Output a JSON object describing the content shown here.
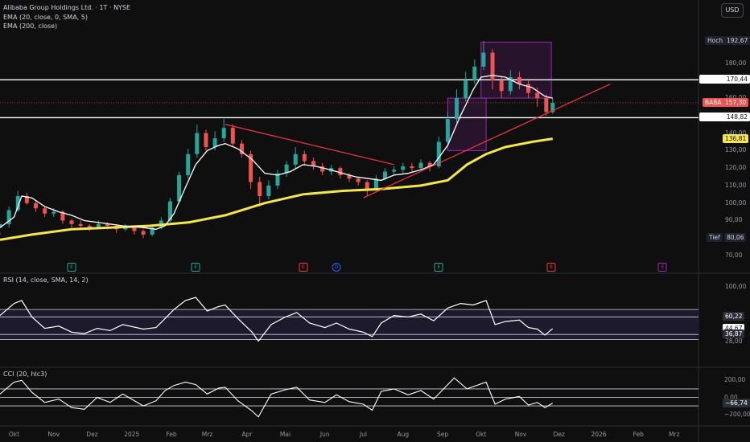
{
  "header": {
    "symbol_title": "Alibaba Group Holdings Ltd. · 1T · NYSE",
    "ema20": "EMA (20, close, 0, SMA, 5)",
    "ema200": "EMA (200, close)",
    "currency_button": "USD"
  },
  "colors": {
    "background": "#0f0f0f",
    "candle_up": "#26a69a",
    "candle_down": "#ef5350",
    "ema20": "#ffffff",
    "ema200": "#f5e649",
    "trendline": "#f23645",
    "box": "#9c27b0",
    "rsi_band": "#1e1a2e"
  },
  "price_tags": {
    "high_label": "Hoch",
    "high_value": "192,67",
    "low_label": "Tief",
    "low_value": "80,06",
    "symbol": "BABA",
    "last": "157,30",
    "level1": "170,44",
    "level2": "148,82",
    "ema200_value": "136,81"
  },
  "price_axis": [
    "180,00",
    "170,00",
    "160,00",
    "150,00",
    "140,00",
    "130,00",
    "120,00",
    "110,00",
    "100,00",
    "90,00",
    "80,00",
    "70,00"
  ],
  "rsi": {
    "label": "RSI (14, close, SMA, 14, 2)",
    "axis": [
      "100,00",
      "28,00"
    ],
    "tags": {
      "ma": "60,22",
      "value": "44,67",
      "lower": "36,87"
    }
  },
  "cci": {
    "label": "CCI (20, hlc3)",
    "axis": [
      "200,00",
      "0,00",
      "−200,00"
    ],
    "tags": {
      "value": "−66,74"
    }
  },
  "time_axis": [
    "Okt",
    "Nov",
    "Dez",
    "2025",
    "Feb",
    "Mrz",
    "Apr",
    "Mai",
    "Jun",
    "Jul",
    "Aug",
    "Sep",
    "Okt",
    "Nov",
    "Dez",
    "2026",
    "Feb",
    "Mrz"
  ],
  "events": [
    {
      "letter": "E",
      "kind": "earnings-past"
    },
    {
      "letter": "E",
      "kind": "earnings-past"
    },
    {
      "letter": "E",
      "kind": "earnings-past-red"
    },
    {
      "letter": "D",
      "kind": "dividend"
    },
    {
      "letter": "E",
      "kind": "earnings-past"
    },
    {
      "letter": "E",
      "kind": "earnings-past-red"
    },
    {
      "letter": "E",
      "kind": "earnings-future"
    }
  ],
  "chart_data": {
    "type": "line",
    "title": "Alibaba Group Holdings Ltd. · 1T · NYSE",
    "ylim": [
      70,
      200
    ],
    "x_range": [
      "2024-09-20",
      "2026-03-20"
    ],
    "series": [
      {
        "name": "EMA (20, close, 0, SMA, 5)",
        "points": [
          [
            "2024-09-20",
            86
          ],
          [
            "2024-10-01",
            92
          ],
          [
            "2024-10-07",
            104
          ],
          [
            "2024-10-15",
            103
          ],
          [
            "2024-10-25",
            98
          ],
          [
            "2024-11-05",
            95
          ],
          [
            "2024-11-15",
            93
          ],
          [
            "2024-11-25",
            90
          ],
          [
            "2024-12-05",
            89
          ],
          [
            "2024-12-15",
            88
          ],
          [
            "2024-12-25",
            87
          ],
          [
            "2025-01-10",
            86
          ],
          [
            "2025-01-20",
            85
          ],
          [
            "2025-01-27",
            87
          ],
          [
            "2025-02-03",
            94
          ],
          [
            "2025-02-12",
            109
          ],
          [
            "2025-02-20",
            122
          ],
          [
            "2025-03-01",
            130
          ],
          [
            "2025-03-10",
            133
          ],
          [
            "2025-03-15",
            134
          ],
          [
            "2025-03-25",
            131
          ],
          [
            "2025-04-05",
            125
          ],
          [
            "2025-04-15",
            117
          ],
          [
            "2025-04-25",
            116
          ],
          [
            "2025-05-05",
            118
          ],
          [
            "2025-05-15",
            122
          ],
          [
            "2025-05-25",
            121
          ],
          [
            "2025-06-05",
            119
          ],
          [
            "2025-06-15",
            117
          ],
          [
            "2025-06-25",
            115
          ],
          [
            "2025-07-05",
            114
          ],
          [
            "2025-07-15",
            113
          ],
          [
            "2025-07-25",
            116
          ],
          [
            "2025-08-05",
            117
          ],
          [
            "2025-08-15",
            119
          ],
          [
            "2025-08-25",
            122
          ],
          [
            "2025-09-05",
            133
          ],
          [
            "2025-09-15",
            150
          ],
          [
            "2025-09-25",
            165
          ],
          [
            "2025-10-01",
            172
          ],
          [
            "2025-10-10",
            173
          ],
          [
            "2025-10-20",
            172
          ],
          [
            "2025-10-31",
            168
          ],
          [
            "2025-11-10",
            166
          ],
          [
            "2025-11-20",
            161
          ],
          [
            "2025-11-26",
            160
          ]
        ]
      },
      {
        "name": "EMA (200, close)",
        "points": [
          [
            "2024-09-20",
            79
          ],
          [
            "2024-10-15",
            82
          ],
          [
            "2024-11-15",
            85
          ],
          [
            "2024-12-15",
            86
          ],
          [
            "2025-01-15",
            87
          ],
          [
            "2025-02-15",
            89
          ],
          [
            "2025-03-15",
            93
          ],
          [
            "2025-04-15",
            100
          ],
          [
            "2025-05-15",
            105
          ],
          [
            "2025-06-15",
            107
          ],
          [
            "2025-07-15",
            108
          ],
          [
            "2025-08-15",
            110
          ],
          [
            "2025-09-05",
            113
          ],
          [
            "2025-09-20",
            122
          ],
          [
            "2025-10-05",
            128
          ],
          [
            "2025-10-20",
            132
          ],
          [
            "2025-11-10",
            135
          ],
          [
            "2025-11-26",
            136.81
          ]
        ]
      }
    ],
    "candles": [
      [
        "2024-09-20",
        86,
        88,
        83,
        82
      ],
      [
        "2024-09-27",
        88,
        96,
        98,
        86
      ],
      [
        "2024-10-04",
        96,
        104,
        107,
        95
      ],
      [
        "2024-10-11",
        104,
        100,
        106,
        99
      ],
      [
        "2024-10-18",
        100,
        97,
        101,
        95
      ],
      [
        "2024-10-25",
        97,
        94,
        98,
        92
      ],
      [
        "2024-11-01",
        94,
        95,
        97,
        92
      ],
      [
        "2024-11-08",
        95,
        90,
        96,
        88
      ],
      [
        "2024-11-15",
        90,
        88,
        91,
        86
      ],
      [
        "2024-11-22",
        88,
        87,
        90,
        85
      ],
      [
        "2024-11-29",
        87,
        86,
        88,
        84
      ],
      [
        "2024-12-06",
        86,
        88,
        90,
        85
      ],
      [
        "2024-12-13",
        88,
        87,
        89,
        85
      ],
      [
        "2024-12-20",
        87,
        85,
        88,
        83
      ],
      [
        "2024-12-27",
        85,
        86,
        88,
        84
      ],
      [
        "2025-01-03",
        86,
        84,
        87,
        82
      ],
      [
        "2025-01-10",
        84,
        82,
        85,
        80
      ],
      [
        "2025-01-17",
        82,
        86,
        87,
        81
      ],
      [
        "2025-01-24",
        86,
        90,
        92,
        85
      ],
      [
        "2025-01-31",
        90,
        101,
        103,
        89
      ],
      [
        "2025-02-07",
        101,
        116,
        118,
        100
      ],
      [
        "2025-02-14",
        116,
        128,
        131,
        114
      ],
      [
        "2025-02-21",
        128,
        140,
        145,
        126
      ],
      [
        "2025-02-28",
        140,
        132,
        142,
        130
      ],
      [
        "2025-03-07",
        132,
        137,
        141,
        130
      ],
      [
        "2025-03-14",
        137,
        143,
        148,
        135
      ],
      [
        "2025-03-21",
        143,
        134,
        145,
        132
      ],
      [
        "2025-03-28",
        134,
        128,
        136,
        126
      ],
      [
        "2025-04-04",
        128,
        112,
        130,
        108
      ],
      [
        "2025-04-11",
        112,
        104,
        115,
        98
      ],
      [
        "2025-04-18",
        104,
        110,
        113,
        102
      ],
      [
        "2025-04-25",
        110,
        117,
        119,
        108
      ],
      [
        "2025-05-02",
        117,
        122,
        124,
        115
      ],
      [
        "2025-05-09",
        122,
        128,
        132,
        120
      ],
      [
        "2025-05-16",
        128,
        124,
        130,
        122
      ],
      [
        "2025-05-23",
        124,
        121,
        126,
        119
      ],
      [
        "2025-05-30",
        121,
        118,
        123,
        116
      ],
      [
        "2025-06-06",
        118,
        120,
        122,
        116
      ],
      [
        "2025-06-13",
        120,
        116,
        121,
        114
      ],
      [
        "2025-06-20",
        116,
        114,
        117,
        112
      ],
      [
        "2025-06-27",
        114,
        112,
        115,
        110
      ],
      [
        "2025-07-04",
        112,
        108,
        113,
        104
      ],
      [
        "2025-07-11",
        108,
        114,
        116,
        107
      ],
      [
        "2025-07-18",
        114,
        118,
        120,
        113
      ],
      [
        "2025-07-25",
        118,
        119,
        121,
        116
      ],
      [
        "2025-08-01",
        119,
        121,
        123,
        117
      ],
      [
        "2025-08-08",
        121,
        120,
        123,
        118
      ],
      [
        "2025-08-15",
        120,
        123,
        125,
        119
      ],
      [
        "2025-08-22",
        123,
        121,
        124,
        118
      ],
      [
        "2025-08-29",
        121,
        135,
        138,
        120
      ],
      [
        "2025-09-05",
        135,
        148,
        152,
        133
      ],
      [
        "2025-09-12",
        148,
        160,
        165,
        146
      ],
      [
        "2025-09-19",
        160,
        170,
        175,
        158
      ],
      [
        "2025-09-26",
        170,
        178,
        182,
        168
      ],
      [
        "2025-10-03",
        178,
        186,
        192.67,
        176
      ],
      [
        "2025-10-10",
        186,
        170,
        188,
        165
      ],
      [
        "2025-10-17",
        170,
        164,
        172,
        160
      ],
      [
        "2025-10-24",
        164,
        172,
        176,
        162
      ],
      [
        "2025-10-31",
        172,
        168,
        175,
        165
      ],
      [
        "2025-11-07",
        168,
        163,
        170,
        160
      ],
      [
        "2025-11-14",
        163,
        160,
        166,
        155
      ],
      [
        "2025-11-21",
        160,
        152,
        162,
        150
      ],
      [
        "2025-11-26",
        152,
        157.3,
        160,
        151
      ]
    ],
    "horizontal_levels": [
      170.44,
      148.82
    ],
    "trendlines": [
      [
        [
          "2025-03-15",
          145
        ],
        [
          "2025-07-25",
          122
        ]
      ],
      [
        [
          "2025-07-01",
          103
        ],
        [
          "2026-01-10",
          168
        ]
      ]
    ],
    "boxes": [
      [
        [
          "2025-09-05",
          160
        ],
        [
          "2025-10-05",
          130
        ]
      ],
      [
        [
          "2025-10-01",
          192
        ],
        [
          "2025-11-25",
          160
        ]
      ]
    ],
    "rsi": {
      "ylim": [
        20,
        100
      ],
      "levels": [
        70,
        60.22,
        36.87,
        30
      ],
      "last": 44.67,
      "points": [
        [
          "2024-09-20",
          62
        ],
        [
          "2024-10-01",
          78
        ],
        [
          "2024-10-07",
          82
        ],
        [
          "2024-10-15",
          60
        ],
        [
          "2024-10-25",
          45
        ],
        [
          "2024-11-05",
          48
        ],
        [
          "2024-11-15",
          40
        ],
        [
          "2024-11-25",
          38
        ],
        [
          "2024-12-05",
          45
        ],
        [
          "2024-12-15",
          42
        ],
        [
          "2024-12-25",
          50
        ],
        [
          "2025-01-10",
          44
        ],
        [
          "2025-01-20",
          46
        ],
        [
          "2025-01-27",
          58
        ],
        [
          "2025-02-03",
          70
        ],
        [
          "2025-02-12",
          82
        ],
        [
          "2025-02-20",
          86
        ],
        [
          "2025-03-01",
          68
        ],
        [
          "2025-03-10",
          74
        ],
        [
          "2025-03-15",
          76
        ],
        [
          "2025-03-25",
          58
        ],
        [
          "2025-04-05",
          40
        ],
        [
          "2025-04-10",
          28
        ],
        [
          "2025-04-20",
          50
        ],
        [
          "2025-05-01",
          60
        ],
        [
          "2025-05-10",
          66
        ],
        [
          "2025-05-20",
          52
        ],
        [
          "2025-06-01",
          46
        ],
        [
          "2025-06-10",
          52
        ],
        [
          "2025-06-20",
          44
        ],
        [
          "2025-07-01",
          40
        ],
        [
          "2025-07-08",
          34
        ],
        [
          "2025-07-15",
          52
        ],
        [
          "2025-07-25",
          62
        ],
        [
          "2025-08-05",
          60
        ],
        [
          "2025-08-15",
          64
        ],
        [
          "2025-08-25",
          55
        ],
        [
          "2025-09-05",
          72
        ],
        [
          "2025-09-15",
          78
        ],
        [
          "2025-09-25",
          76
        ],
        [
          "2025-10-05",
          82
        ],
        [
          "2025-10-12",
          50
        ],
        [
          "2025-10-20",
          54
        ],
        [
          "2025-10-31",
          56
        ],
        [
          "2025-11-07",
          46
        ],
        [
          "2025-11-14",
          44
        ],
        [
          "2025-11-20",
          36
        ],
        [
          "2025-11-26",
          44.67
        ]
      ]
    },
    "cci": {
      "ylim": [
        -260,
        260
      ],
      "levels": [
        100,
        0,
        -100
      ],
      "last": -66.74,
      "points": [
        [
          "2024-09-20",
          40
        ],
        [
          "2024-10-01",
          180
        ],
        [
          "2024-10-07",
          200
        ],
        [
          "2024-10-15",
          60
        ],
        [
          "2024-10-25",
          -60
        ],
        [
          "2024-11-05",
          -20
        ],
        [
          "2024-11-15",
          -120
        ],
        [
          "2024-11-25",
          -140
        ],
        [
          "2024-12-05",
          0
        ],
        [
          "2024-12-15",
          -60
        ],
        [
          "2024-12-25",
          40
        ],
        [
          "2025-01-10",
          -100
        ],
        [
          "2025-01-20",
          -40
        ],
        [
          "2025-01-27",
          80
        ],
        [
          "2025-02-03",
          140
        ],
        [
          "2025-02-12",
          180
        ],
        [
          "2025-02-20",
          150
        ],
        [
          "2025-03-01",
          40
        ],
        [
          "2025-03-10",
          110
        ],
        [
          "2025-03-15",
          120
        ],
        [
          "2025-03-25",
          -40
        ],
        [
          "2025-04-05",
          -160
        ],
        [
          "2025-04-10",
          -230
        ],
        [
          "2025-04-20",
          40
        ],
        [
          "2025-05-01",
          90
        ],
        [
          "2025-05-10",
          120
        ],
        [
          "2025-05-20",
          -30
        ],
        [
          "2025-06-01",
          -60
        ],
        [
          "2025-06-10",
          30
        ],
        [
          "2025-06-20",
          -50
        ],
        [
          "2025-07-01",
          -80
        ],
        [
          "2025-07-08",
          -150
        ],
        [
          "2025-07-15",
          70
        ],
        [
          "2025-07-25",
          100
        ],
        [
          "2025-08-05",
          30
        ],
        [
          "2025-08-15",
          80
        ],
        [
          "2025-08-25",
          -20
        ],
        [
          "2025-09-05",
          150
        ],
        [
          "2025-09-10",
          230
        ],
        [
          "2025-09-20",
          100
        ],
        [
          "2025-10-05",
          180
        ],
        [
          "2025-10-12",
          -80
        ],
        [
          "2025-10-20",
          -20
        ],
        [
          "2025-10-31",
          10
        ],
        [
          "2025-11-07",
          -90
        ],
        [
          "2025-11-14",
          -60
        ],
        [
          "2025-11-20",
          -120
        ],
        [
          "2025-11-26",
          -66.74
        ]
      ]
    }
  }
}
